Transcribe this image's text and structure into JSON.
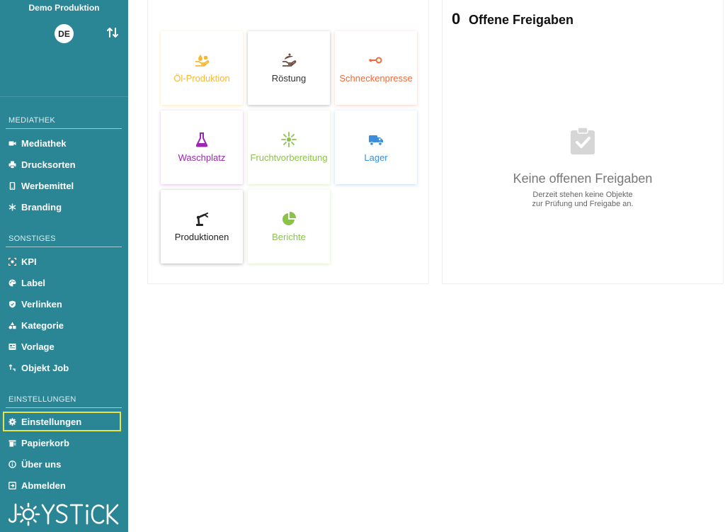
{
  "sidebar": {
    "org_name": "Demo Produktion",
    "language": "DE",
    "sections": [
      {
        "title": "MEDIATHEK"
      },
      {
        "title": "SONSTIGES"
      },
      {
        "title": "EINSTELLUNGEN"
      }
    ],
    "items": [
      {
        "label": "Mediathek",
        "icon": "video-camera-icon"
      },
      {
        "label": "Drucksorten",
        "icon": "printer-icon"
      },
      {
        "label": "Werbemittel",
        "icon": "mobile-icon"
      },
      {
        "label": "Branding",
        "icon": "snowflake-icon"
      },
      {
        "label": "KPI",
        "icon": "target-icon"
      },
      {
        "label": "Label",
        "icon": "palette-icon"
      },
      {
        "label": "Verlinken",
        "icon": "shield-icon"
      },
      {
        "label": "Kategorie",
        "icon": "shapes-icon"
      },
      {
        "label": "Vorlage",
        "icon": "template-icon"
      },
      {
        "label": "Objekt Job",
        "icon": "job-icon"
      },
      {
        "label": "Einstellungen",
        "icon": "gear-icon",
        "active": true
      },
      {
        "label": "Papierkorb",
        "icon": "trash-icon"
      },
      {
        "label": "Über uns",
        "icon": "info-icon"
      },
      {
        "label": "Abmelden",
        "icon": "logout-icon"
      }
    ],
    "logo_text": "JOYSTICK"
  },
  "tiles": [
    {
      "label": "Öl-Produktion",
      "color": "#f5b93a",
      "icon": "oil-hand-icon"
    },
    {
      "label": "Röstung",
      "color": "#6d4c41",
      "icon": "roast-hand-icon"
    },
    {
      "label": "Schneckenpresse",
      "color": "#ef6b3a",
      "icon": "key-icon"
    },
    {
      "label": "Waschplatz",
      "color": "#9c27b0",
      "icon": "flask-icon"
    },
    {
      "label": "Fruchtvorbereitung",
      "color": "#8bc34a",
      "icon": "sparkle-icon"
    },
    {
      "label": "Lager",
      "color": "#3a8edb",
      "icon": "truck-icon"
    },
    {
      "label": "Produktionen",
      "color": "#222222",
      "icon": "robot-arm-icon"
    },
    {
      "label": "Berichte",
      "color": "#8bc34a",
      "icon": "pie-chart-icon"
    }
  ],
  "approvals": {
    "count": "0",
    "title": "Offene Freigaben",
    "empty_title": "Keine offenen Freigaben",
    "empty_desc_line1": "Derzeit stehen keine Objekte",
    "empty_desc_line2": "zur Prüfung und Freigabe an."
  },
  "colors": {
    "sidebar_bg": "#2a8595",
    "active_outline": "#e8e34a"
  }
}
